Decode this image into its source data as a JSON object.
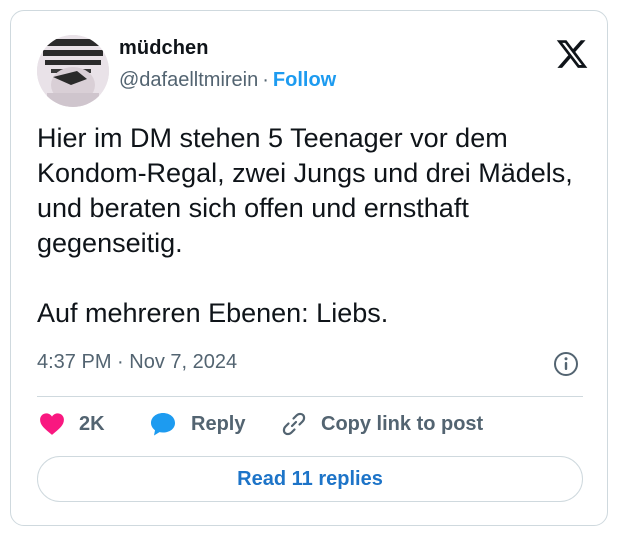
{
  "author": {
    "display_name": "müdchen",
    "handle": "@dafaelltmirein",
    "separator": "·",
    "follow_label": "Follow"
  },
  "tweet": {
    "text": "Hier im DM stehen 5 Teenager vor dem Kondom-Regal, zwei Jungs und drei Mädels, und beraten sich offen und ernsthaft gegenseitig.\n\nAuf mehreren Ebenen: Liebs.",
    "timestamp": "4:37 PM · Nov 7, 2024"
  },
  "actions": {
    "like_count": "2K",
    "reply_label": "Reply",
    "copy_link_label": "Copy link to post"
  },
  "read_replies_label": "Read 11 replies",
  "icons": {
    "brand": "x-logo-icon",
    "info": "info-icon",
    "like": "heart-icon",
    "reply": "speech-bubble-icon",
    "copy": "link-icon"
  },
  "colors": {
    "accent": "#1d9bf0",
    "like": "#f91880",
    "text": "#0f1419",
    "secondary": "#536471",
    "border": "#cfd9de"
  }
}
